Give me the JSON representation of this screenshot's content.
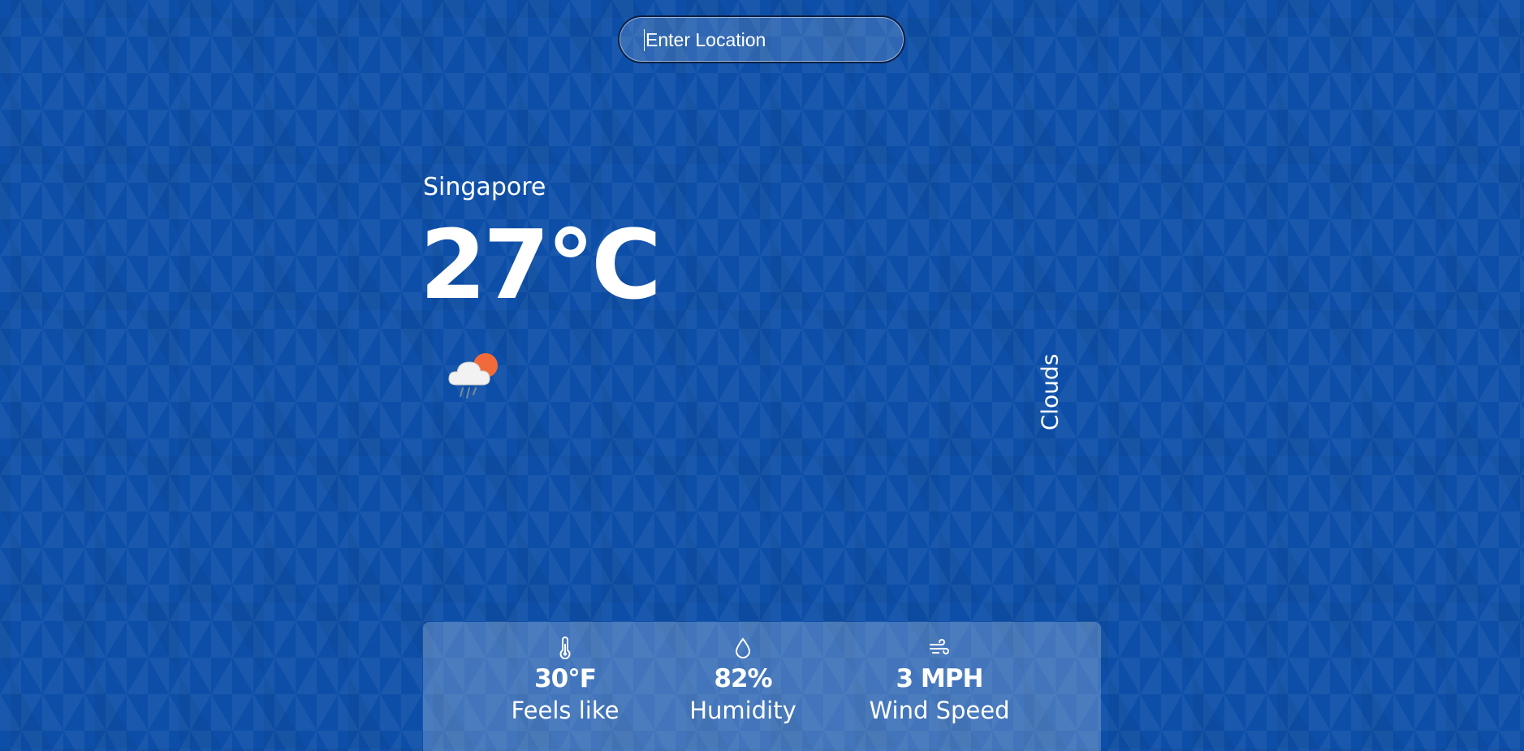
{
  "search": {
    "placeholder": "Enter Location",
    "value": ""
  },
  "location": {
    "city": "Singapore"
  },
  "current": {
    "temperature": "27°C",
    "condition": "Clouds",
    "icon": "partly-cloudy-rain-icon"
  },
  "stats": [
    {
      "icon": "thermometer-icon",
      "value": "30°F",
      "label": "Feels like"
    },
    {
      "icon": "water-drop-icon",
      "value": "82%",
      "label": "Humidity"
    },
    {
      "icon": "wind-icon",
      "value": "3 MPH",
      "label": "Wind Speed"
    }
  ],
  "colors": {
    "background": "#0d4fa8",
    "text": "#ffffff",
    "sun": "#f26a3a",
    "cloud": "#f2f2f2"
  }
}
